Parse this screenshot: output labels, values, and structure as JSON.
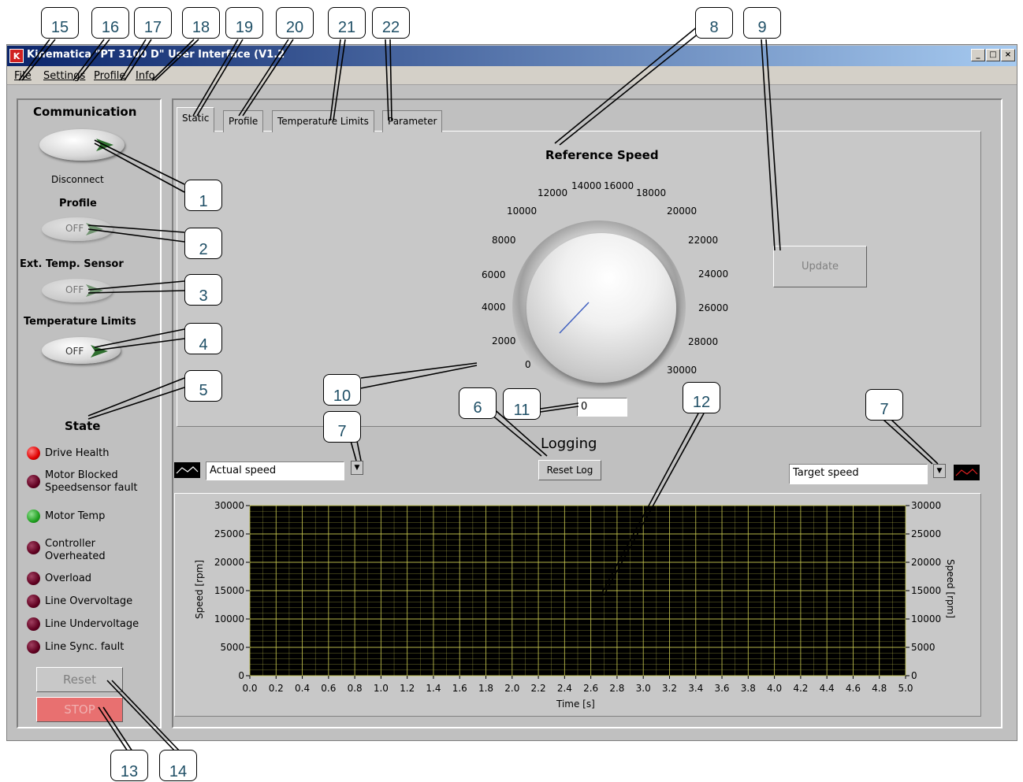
{
  "window": {
    "title": "Kinematica \"PT 3100 D\" User Interface (V1.2",
    "app_icon": "K",
    "controls": {
      "minimize": "_",
      "maximize": "□",
      "close": "×"
    }
  },
  "menu": [
    "File",
    "Settings",
    "Profile",
    "Info"
  ],
  "left": {
    "communication": {
      "heading": "Communication",
      "button_label": "Disconnect"
    },
    "profile": {
      "heading": "Profile",
      "toggle": "OFF"
    },
    "ext_temp": {
      "heading": "Ext. Temp. Sensor",
      "toggle": "OFF"
    },
    "temp_limits": {
      "heading": "Temperature Limits",
      "toggle": "OFF"
    },
    "state": {
      "heading": "State",
      "items": [
        {
          "label": "Drive Health",
          "led": "red-on"
        },
        {
          "label": "Motor Blocked\nSpeedsensor fault",
          "led": "red-off"
        },
        {
          "label": "Motor Temp",
          "led": "green-on"
        },
        {
          "label": "Controller\nOverheated",
          "led": "red-off"
        },
        {
          "label": "Overload",
          "led": "red-off"
        },
        {
          "label": "Line Overvoltage",
          "led": "red-off"
        },
        {
          "label": "Line Undervoltage",
          "led": "red-off"
        },
        {
          "label": "Line Sync. fault",
          "led": "red-off"
        }
      ]
    },
    "reset_label": "Reset",
    "stop_label": "STOP"
  },
  "tabs": [
    "Static",
    "Profile",
    "Temperature Limits",
    "Parameter"
  ],
  "static": {
    "knob_title": "Reference Speed",
    "knob_ticks": [
      "0",
      "2000",
      "4000",
      "6000",
      "8000",
      "10000",
      "12000",
      "14000",
      "16000",
      "18000",
      "20000",
      "22000",
      "24000",
      "26000",
      "28000",
      "30000"
    ],
    "knob_value": "0",
    "update_label": "Update"
  },
  "logging": {
    "title": "Logging",
    "reset_label": "Reset Log",
    "left_series": "Actual speed",
    "right_series": "Target speed",
    "left_ylabel": "Speed [rpm]",
    "right_ylabel": "Speed [rpm]",
    "xlabel": "Time [s]",
    "y_ticks": [
      "30000",
      "25000",
      "20000",
      "15000",
      "10000",
      "5000",
      "0"
    ],
    "x_ticks": [
      "0.0",
      "0.2",
      "0.4",
      "0.6",
      "0.8",
      "1.0",
      "1.2",
      "1.4",
      "1.6",
      "1.8",
      "2.0",
      "2.2",
      "2.4",
      "2.6",
      "2.8",
      "3.0",
      "3.2",
      "3.4",
      "3.6",
      "3.8",
      "4.0",
      "4.2",
      "4.4",
      "4.6",
      "4.8",
      "5.0"
    ]
  },
  "chart_data": {
    "type": "line",
    "title": "",
    "xlabel": "Time [s]",
    "ylabel": "Speed [rpm]",
    "xlim": [
      0,
      5
    ],
    "ylim": [
      0,
      30000
    ],
    "grid": true,
    "series": [
      {
        "name": "Actual speed",
        "x": [],
        "y": []
      },
      {
        "name": "Target speed",
        "x": [],
        "y": []
      }
    ]
  },
  "colors": {
    "plot_bg": "#000000",
    "grid": "#c8c850",
    "led_red": "#e00000",
    "led_green": "#20a020",
    "stop": "#e87070"
  },
  "callouts": [
    "1",
    "2",
    "3",
    "4",
    "5",
    "6",
    "7",
    "7",
    "8",
    "9",
    "10",
    "11",
    "12",
    "13",
    "14",
    "15",
    "16",
    "17",
    "18",
    "19",
    "20",
    "21",
    "22"
  ]
}
